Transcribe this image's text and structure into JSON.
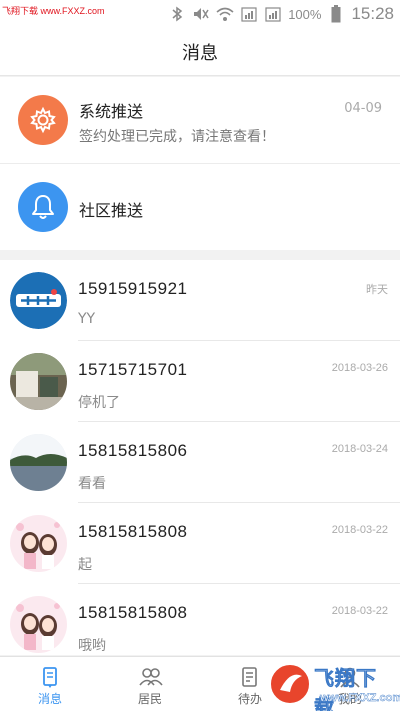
{
  "watermark": {
    "top_left": "飞翔下载 www.FXXZ.com",
    "logo_text": "飞翔下载",
    "logo_url": "www.FXXZ.com"
  },
  "status_bar": {
    "battery_percent": "100%",
    "time": "15:28"
  },
  "header": {
    "title": "消息"
  },
  "system_items": [
    {
      "title": "系统推送",
      "subtitle": "签约处理已完成，请注意查看！",
      "date": "04-09",
      "icon": "gear-icon",
      "color": "#f37a4a"
    },
    {
      "title": "社区推送",
      "icon": "bell-icon",
      "color": "#3c95f0"
    }
  ],
  "conversations": [
    {
      "name": "15915915921",
      "message": "YY",
      "time": "昨天",
      "avatar": "logo-avatar",
      "avatar_label": "社区"
    },
    {
      "name": "15715715701",
      "message": "停机了",
      "time": "2018-03-26",
      "avatar": "photo-avatar"
    },
    {
      "name": "15815815806",
      "message": "看看",
      "time": "2018-03-24",
      "avatar": "lake-avatar"
    },
    {
      "name": "15815815808",
      "message": "起",
      "time": "2018-03-22",
      "avatar": "anime-avatar"
    },
    {
      "name": "15815815808",
      "message": "哦哟",
      "time": "2018-03-22",
      "avatar": "anime-avatar"
    }
  ],
  "tabs": [
    {
      "label": "消息",
      "icon": "message-icon",
      "active": true
    },
    {
      "label": "居民",
      "icon": "residents-icon",
      "active": false
    },
    {
      "label": "待办",
      "icon": "todo-icon",
      "active": false
    },
    {
      "label": "我的",
      "icon": "profile-icon",
      "active": false
    }
  ],
  "colors": {
    "accent": "#3c95f0",
    "system_orange": "#f37a4a"
  }
}
